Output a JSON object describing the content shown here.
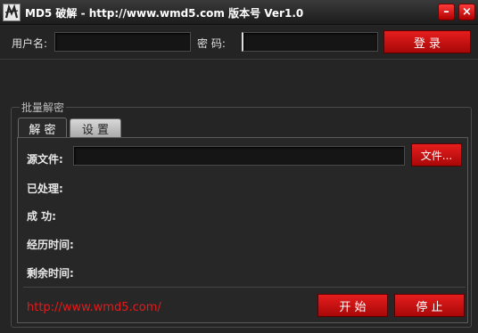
{
  "window": {
    "title": "MD5 破解 - http://www.wmd5.com  版本号 Ver1.0",
    "minimize_glyph": "–",
    "close_glyph": "×"
  },
  "login": {
    "username_label": "用户名:",
    "username_value": "",
    "password_label": "密   码:",
    "password_value": "",
    "login_button": "登   录"
  },
  "group": {
    "label": "批量解密",
    "tabs": [
      {
        "label": "解  密",
        "active": true
      },
      {
        "label": "设  置",
        "active": false
      }
    ]
  },
  "decrypt": {
    "source_label": "源文件:",
    "source_value": "",
    "file_button": "文件...",
    "processed_label": "已处理:",
    "processed_value": "",
    "success_label": "成  功:",
    "success_value": "",
    "elapsed_label": "经历时间:",
    "elapsed_value": "",
    "remaining_label": "剩余时间:",
    "remaining_value": "",
    "link_text": "http://www.wmd5.com/",
    "start_button": "开   始",
    "stop_button": "停   止"
  },
  "colors": {
    "accent_red": "#d01212",
    "link_red": "#e41b1b",
    "background": "#252525"
  },
  "icons": {
    "app": "app-logo-icon",
    "minimize": "minimize-icon",
    "close": "close-icon"
  }
}
